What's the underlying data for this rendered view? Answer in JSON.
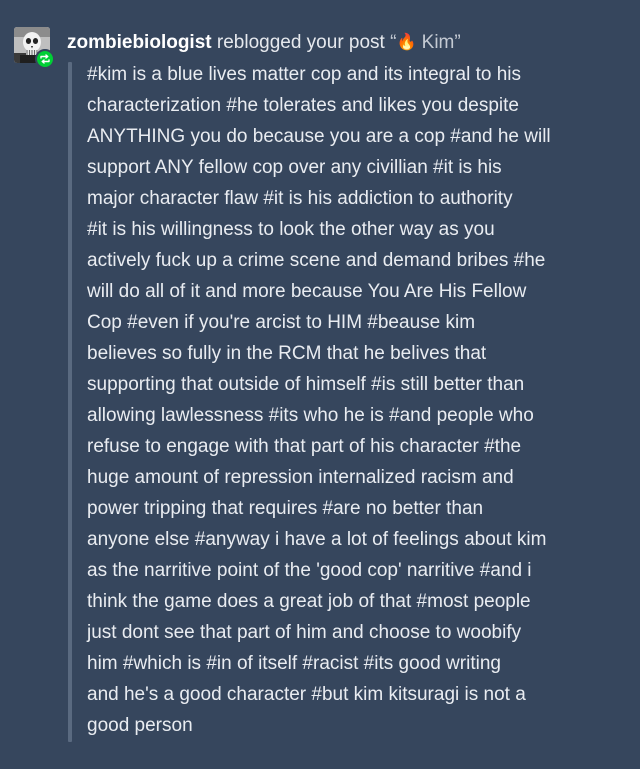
{
  "notification": {
    "username": "zombiebiologist",
    "action": "reblogged your post",
    "post_title_open": "“",
    "post_title_emoji": "🔥",
    "post_title": " Kim”",
    "avatar_icon": "skull-avatar-icon",
    "badge_icon": "reblog-icon",
    "badge_color": "#00cf35",
    "background_color": "#36465d"
  },
  "tags": [
    "#kim is a blue lives matter cop and its integral to his",
    "characterization #he tolerates and likes you despite",
    "ANYTHING you do because you are a cop #and he will",
    "support ANY fellow cop over any civillian #it is his",
    "major character flaw #it is his addiction to authority",
    "#it is his willingness to look the other way as you",
    "actively fuck up a crime scene and demand bribes #he",
    "will do all of it and more because You Are His Fellow",
    "Cop #even if you're arcist to HIM #beause kim",
    "believes so fully in the RCM that he belives that",
    "supporting that outside of himself #is still better than",
    "allowing lawlessness #its who he is #and people who",
    "refuse to engage with that part of his character #the",
    "huge amount of repression internalized racism and",
    "power tripping that requires #are no better than",
    "anyone else #anyway i have a lot of feelings about kim",
    "as the narritive point of the 'good cop' narritive #and i",
    "think the game does a great job of that #most people",
    "just dont see that part of him and choose to woobify",
    "him #which is #in of itself #racist #its good writing",
    "and he's a good character #but kim kitsuragi is not a",
    "good person"
  ]
}
